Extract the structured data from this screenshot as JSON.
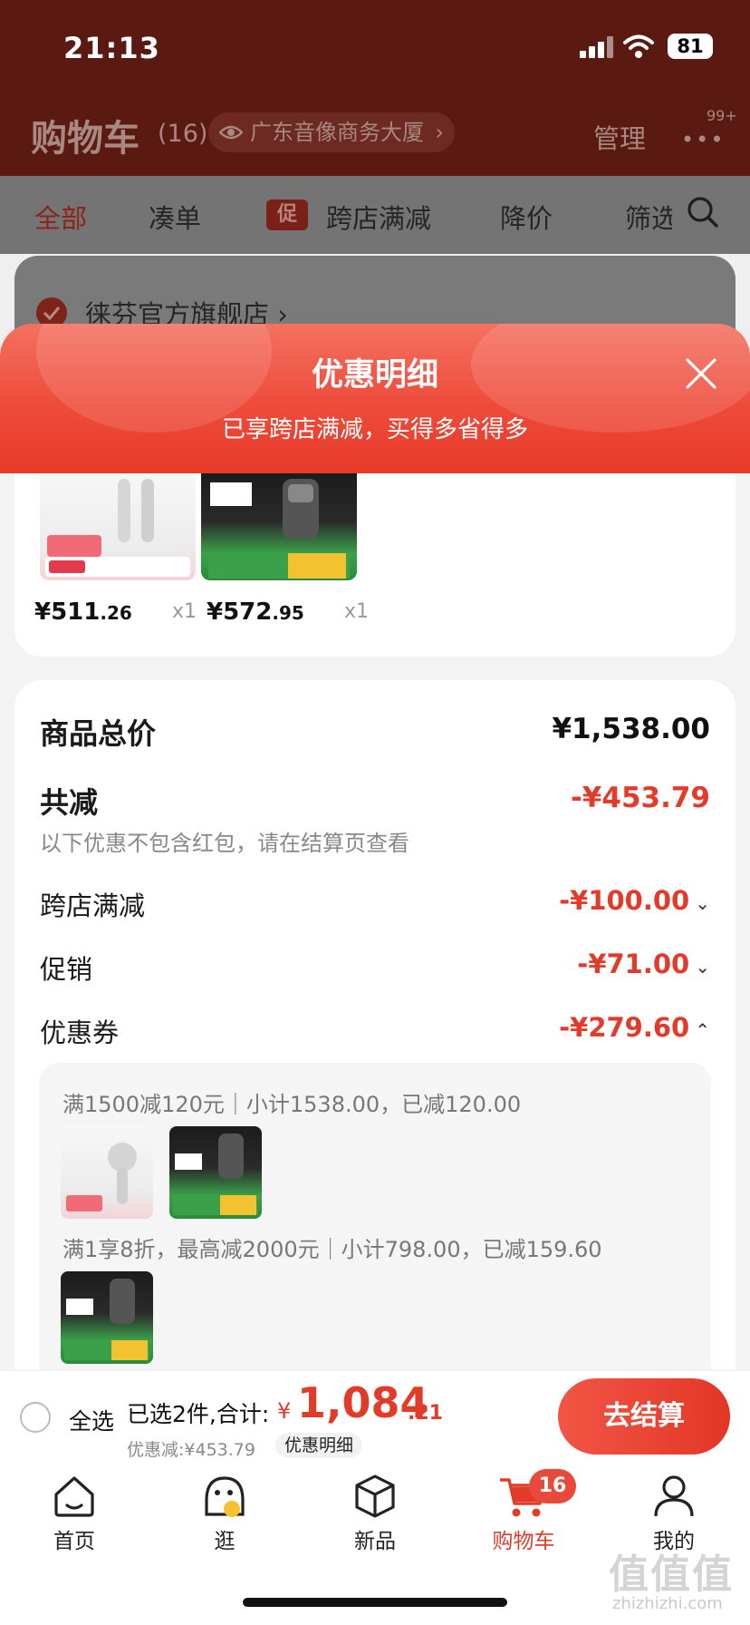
{
  "status_bar": {
    "time": "21:13",
    "battery": "81"
  },
  "header": {
    "title": "购物车",
    "count": "(16)",
    "location": "广东音像商务大厦",
    "manage": "管理",
    "more_badge": "99+"
  },
  "filters": {
    "all": "全部",
    "combine": "凑单",
    "promo_tag": "促",
    "cross_store": "跨店满减",
    "price_drop": "降价",
    "filter": "筛选"
  },
  "store": {
    "name": "徕芬官方旗舰店 ›"
  },
  "sheet": {
    "title": "优惠明细",
    "subtitle": "已享跨店满减，买得多省得多"
  },
  "items": [
    {
      "price_main": "¥511",
      "price_cents": ".26",
      "qty": "x1",
      "thumb": "hair-dryer"
    },
    {
      "price_main": "¥572",
      "price_cents": ".95",
      "qty": "x1",
      "thumb": "electric-shaver"
    }
  ],
  "detail": {
    "total_label": "商品总价",
    "total_value": "¥1,538.00",
    "reduce_label": "共减",
    "reduce_value": "-¥453.79",
    "reduce_note": "以下优惠不包含红包，请在结算页查看",
    "rows": [
      {
        "label": "跨店满减",
        "value": "-¥100.00"
      },
      {
        "label": "促销",
        "value": "-¥71.00"
      },
      {
        "label": "优惠券",
        "value": "-¥279.60"
      }
    ],
    "coupon_lines": [
      "满1500减120元｜小计1538.00，已减120.00",
      "满1享8折，最高减2000元｜小计798.00，已减159.60"
    ]
  },
  "checkout": {
    "select_all": "全选",
    "selected": "已选2件,合计:",
    "yen": "¥",
    "total_main": "1,084",
    "total_cents": ".21",
    "discount": "优惠减:¥453.79",
    "detail_link": "优惠明细",
    "button": "去结算"
  },
  "tabs": [
    {
      "label": "首页"
    },
    {
      "label": "逛"
    },
    {
      "label": "新品"
    },
    {
      "label": "购物车",
      "badge": "16"
    },
    {
      "label": "我的"
    }
  ],
  "watermark": {
    "main": "值值值",
    "sub": "zhizhizhi.com"
  },
  "colors": {
    "accent": "#e23b2a",
    "sheet_header": "#ee4b3a",
    "header_bg": "#5a1a12"
  }
}
